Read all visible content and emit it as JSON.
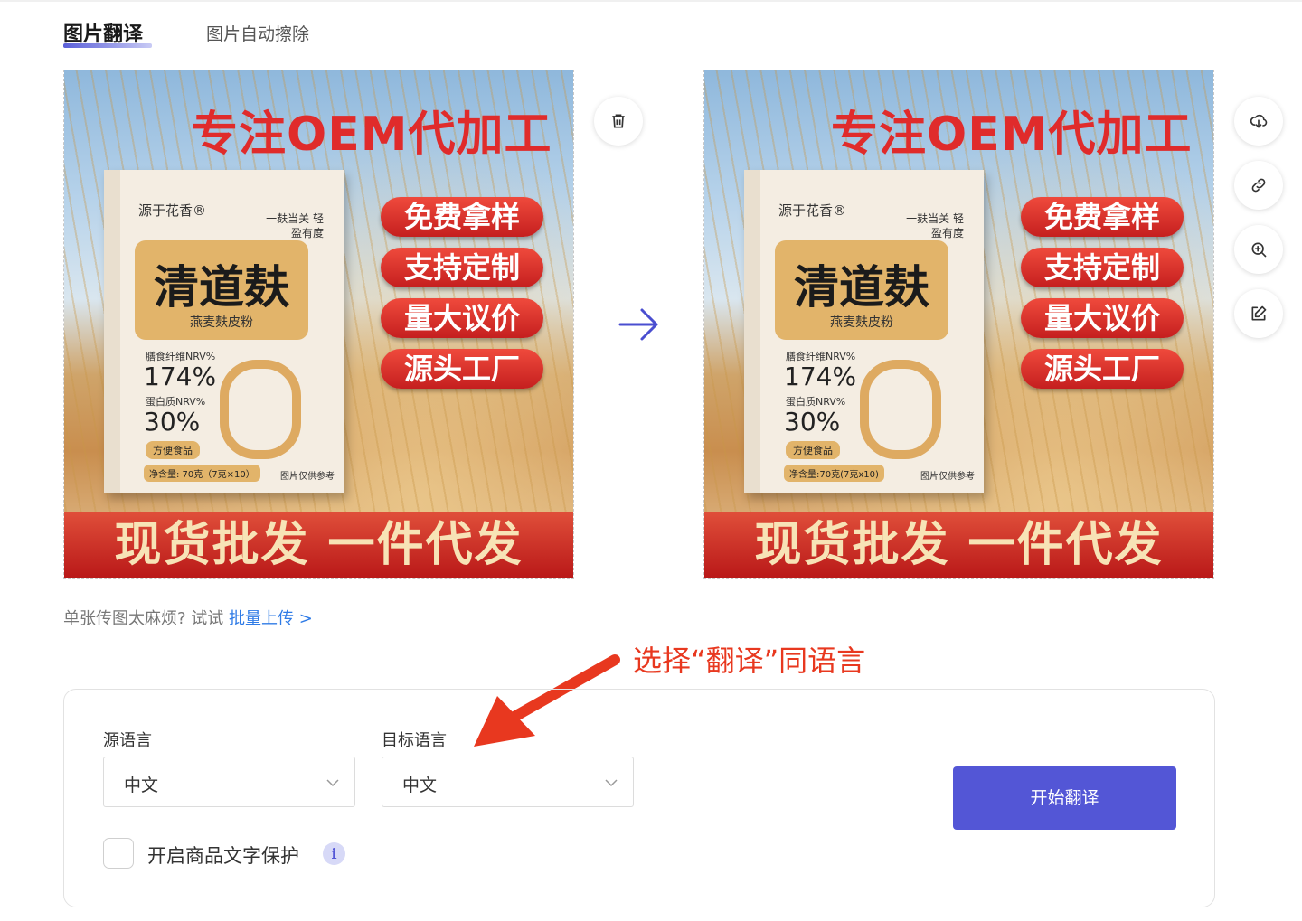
{
  "tabs": {
    "active": "图片翻译",
    "inactive": "图片自动擦除"
  },
  "product_image": {
    "headline": "专注OEM代加工",
    "brand": "源于花香®",
    "tagline": "一麸当关 轻盈有度",
    "product_name": "清道麸",
    "product_sub": "燕麦麸皮粉",
    "nutrient1_label": "膳食纤维NRV%",
    "nutrient1_value": "174%",
    "nutrient2_label": "蛋白质NRV%",
    "nutrient2_value": "30%",
    "pill": "方便食品",
    "net_left": "净含量: 70克（7克×10）",
    "net_right": "净含量:70克(7克x10)",
    "reference": "图片仅供参考",
    "badges": [
      "免费拿样",
      "支持定制",
      "量大议价",
      "源头工厂"
    ],
    "banner": "现货批发 一件代发"
  },
  "hint": {
    "text": "单张传图太麻烦? 试试 ",
    "link": "批量上传 >"
  },
  "annotation": {
    "text": "选择“翻译”同语言",
    "color": "#e8381f"
  },
  "settings": {
    "source_label": "源语言",
    "source_value": "中文",
    "target_label": "目标语言",
    "target_value": "中文",
    "start_button": "开始翻译",
    "protect_label": "开启商品文字保护",
    "protect_checked": false,
    "info_icon": "i"
  },
  "side_icons": [
    "trash-icon",
    "cloud-download-icon",
    "link-icon",
    "zoom-in-icon",
    "edit-icon"
  ],
  "colors": {
    "primary": "#5356d6",
    "link": "#2f7be6",
    "banner_red": "#c51f1f"
  }
}
